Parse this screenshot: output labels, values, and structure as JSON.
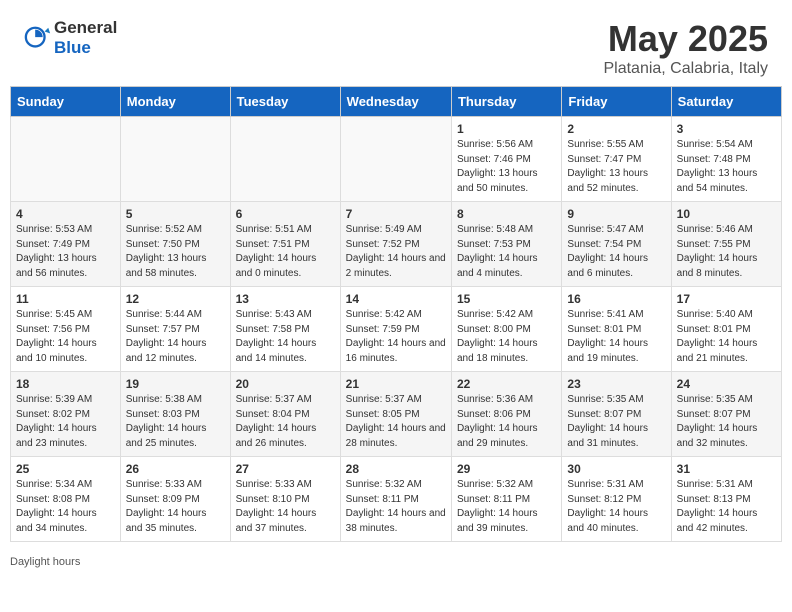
{
  "header": {
    "logo_general": "General",
    "logo_blue": "Blue",
    "month": "May 2025",
    "location": "Platania, Calabria, Italy"
  },
  "footer": {
    "label": "Daylight hours"
  },
  "weekdays": [
    "Sunday",
    "Monday",
    "Tuesday",
    "Wednesday",
    "Thursday",
    "Friday",
    "Saturday"
  ],
  "weeks": [
    [
      {
        "day": "",
        "sunrise": "",
        "sunset": "",
        "daylight": ""
      },
      {
        "day": "",
        "sunrise": "",
        "sunset": "",
        "daylight": ""
      },
      {
        "day": "",
        "sunrise": "",
        "sunset": "",
        "daylight": ""
      },
      {
        "day": "",
        "sunrise": "",
        "sunset": "",
        "daylight": ""
      },
      {
        "day": "1",
        "sunrise": "Sunrise: 5:56 AM",
        "sunset": "Sunset: 7:46 PM",
        "daylight": "Daylight: 13 hours and 50 minutes."
      },
      {
        "day": "2",
        "sunrise": "Sunrise: 5:55 AM",
        "sunset": "Sunset: 7:47 PM",
        "daylight": "Daylight: 13 hours and 52 minutes."
      },
      {
        "day": "3",
        "sunrise": "Sunrise: 5:54 AM",
        "sunset": "Sunset: 7:48 PM",
        "daylight": "Daylight: 13 hours and 54 minutes."
      }
    ],
    [
      {
        "day": "4",
        "sunrise": "Sunrise: 5:53 AM",
        "sunset": "Sunset: 7:49 PM",
        "daylight": "Daylight: 13 hours and 56 minutes."
      },
      {
        "day": "5",
        "sunrise": "Sunrise: 5:52 AM",
        "sunset": "Sunset: 7:50 PM",
        "daylight": "Daylight: 13 hours and 58 minutes."
      },
      {
        "day": "6",
        "sunrise": "Sunrise: 5:51 AM",
        "sunset": "Sunset: 7:51 PM",
        "daylight": "Daylight: 14 hours and 0 minutes."
      },
      {
        "day": "7",
        "sunrise": "Sunrise: 5:49 AM",
        "sunset": "Sunset: 7:52 PM",
        "daylight": "Daylight: 14 hours and 2 minutes."
      },
      {
        "day": "8",
        "sunrise": "Sunrise: 5:48 AM",
        "sunset": "Sunset: 7:53 PM",
        "daylight": "Daylight: 14 hours and 4 minutes."
      },
      {
        "day": "9",
        "sunrise": "Sunrise: 5:47 AM",
        "sunset": "Sunset: 7:54 PM",
        "daylight": "Daylight: 14 hours and 6 minutes."
      },
      {
        "day": "10",
        "sunrise": "Sunrise: 5:46 AM",
        "sunset": "Sunset: 7:55 PM",
        "daylight": "Daylight: 14 hours and 8 minutes."
      }
    ],
    [
      {
        "day": "11",
        "sunrise": "Sunrise: 5:45 AM",
        "sunset": "Sunset: 7:56 PM",
        "daylight": "Daylight: 14 hours and 10 minutes."
      },
      {
        "day": "12",
        "sunrise": "Sunrise: 5:44 AM",
        "sunset": "Sunset: 7:57 PM",
        "daylight": "Daylight: 14 hours and 12 minutes."
      },
      {
        "day": "13",
        "sunrise": "Sunrise: 5:43 AM",
        "sunset": "Sunset: 7:58 PM",
        "daylight": "Daylight: 14 hours and 14 minutes."
      },
      {
        "day": "14",
        "sunrise": "Sunrise: 5:42 AM",
        "sunset": "Sunset: 7:59 PM",
        "daylight": "Daylight: 14 hours and 16 minutes."
      },
      {
        "day": "15",
        "sunrise": "Sunrise: 5:42 AM",
        "sunset": "Sunset: 8:00 PM",
        "daylight": "Daylight: 14 hours and 18 minutes."
      },
      {
        "day": "16",
        "sunrise": "Sunrise: 5:41 AM",
        "sunset": "Sunset: 8:01 PM",
        "daylight": "Daylight: 14 hours and 19 minutes."
      },
      {
        "day": "17",
        "sunrise": "Sunrise: 5:40 AM",
        "sunset": "Sunset: 8:01 PM",
        "daylight": "Daylight: 14 hours and 21 minutes."
      }
    ],
    [
      {
        "day": "18",
        "sunrise": "Sunrise: 5:39 AM",
        "sunset": "Sunset: 8:02 PM",
        "daylight": "Daylight: 14 hours and 23 minutes."
      },
      {
        "day": "19",
        "sunrise": "Sunrise: 5:38 AM",
        "sunset": "Sunset: 8:03 PM",
        "daylight": "Daylight: 14 hours and 25 minutes."
      },
      {
        "day": "20",
        "sunrise": "Sunrise: 5:37 AM",
        "sunset": "Sunset: 8:04 PM",
        "daylight": "Daylight: 14 hours and 26 minutes."
      },
      {
        "day": "21",
        "sunrise": "Sunrise: 5:37 AM",
        "sunset": "Sunset: 8:05 PM",
        "daylight": "Daylight: 14 hours and 28 minutes."
      },
      {
        "day": "22",
        "sunrise": "Sunrise: 5:36 AM",
        "sunset": "Sunset: 8:06 PM",
        "daylight": "Daylight: 14 hours and 29 minutes."
      },
      {
        "day": "23",
        "sunrise": "Sunrise: 5:35 AM",
        "sunset": "Sunset: 8:07 PM",
        "daylight": "Daylight: 14 hours and 31 minutes."
      },
      {
        "day": "24",
        "sunrise": "Sunrise: 5:35 AM",
        "sunset": "Sunset: 8:07 PM",
        "daylight": "Daylight: 14 hours and 32 minutes."
      }
    ],
    [
      {
        "day": "25",
        "sunrise": "Sunrise: 5:34 AM",
        "sunset": "Sunset: 8:08 PM",
        "daylight": "Daylight: 14 hours and 34 minutes."
      },
      {
        "day": "26",
        "sunrise": "Sunrise: 5:33 AM",
        "sunset": "Sunset: 8:09 PM",
        "daylight": "Daylight: 14 hours and 35 minutes."
      },
      {
        "day": "27",
        "sunrise": "Sunrise: 5:33 AM",
        "sunset": "Sunset: 8:10 PM",
        "daylight": "Daylight: 14 hours and 37 minutes."
      },
      {
        "day": "28",
        "sunrise": "Sunrise: 5:32 AM",
        "sunset": "Sunset: 8:11 PM",
        "daylight": "Daylight: 14 hours and 38 minutes."
      },
      {
        "day": "29",
        "sunrise": "Sunrise: 5:32 AM",
        "sunset": "Sunset: 8:11 PM",
        "daylight": "Daylight: 14 hours and 39 minutes."
      },
      {
        "day": "30",
        "sunrise": "Sunrise: 5:31 AM",
        "sunset": "Sunset: 8:12 PM",
        "daylight": "Daylight: 14 hours and 40 minutes."
      },
      {
        "day": "31",
        "sunrise": "Sunrise: 5:31 AM",
        "sunset": "Sunset: 8:13 PM",
        "daylight": "Daylight: 14 hours and 42 minutes."
      }
    ]
  ]
}
